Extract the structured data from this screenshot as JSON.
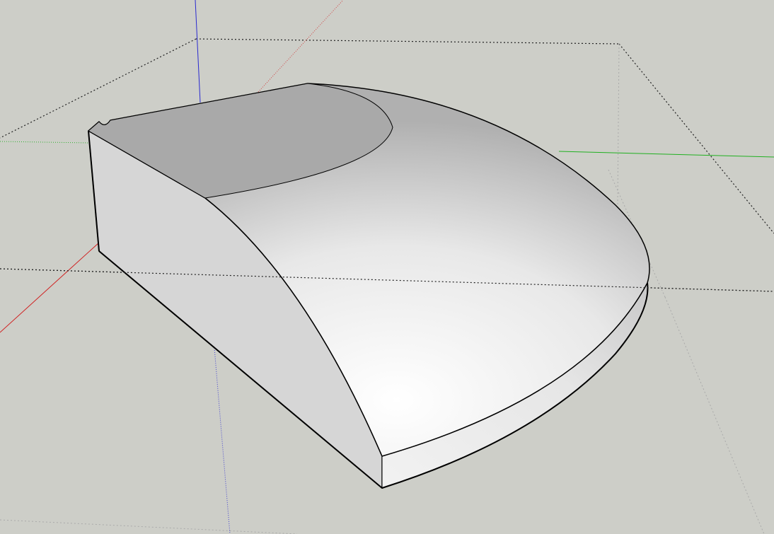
{
  "viewport": {
    "background": "#cdcec8",
    "axis_colors": {
      "red": "#d02020",
      "green": "#20b020",
      "blue": "#2020d0"
    },
    "model_edge_color": "#000000",
    "face_colors": {
      "top_dark": "#a9a9a9",
      "top_light": "#ffffff",
      "side": "#d6d6d6",
      "back": "#e6e6e6"
    }
  }
}
